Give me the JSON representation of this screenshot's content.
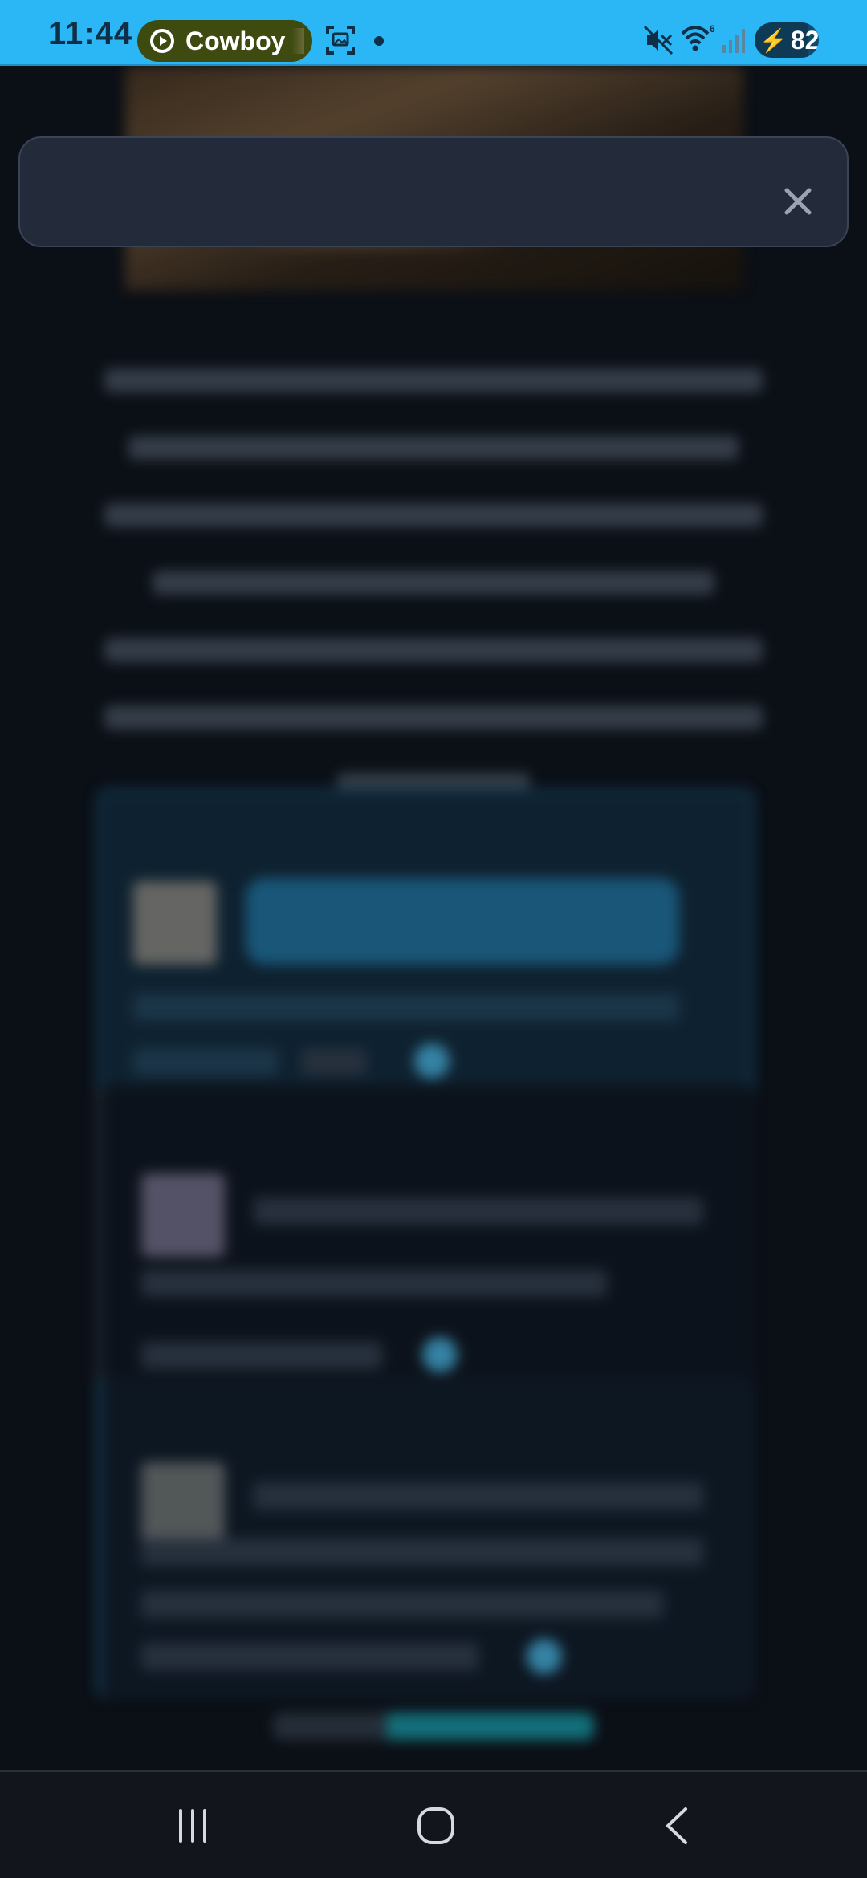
{
  "status_bar": {
    "time": "11:44",
    "media_app": "Cowboy",
    "battery_level": 82,
    "battery_text": "82",
    "colors": {
      "background": "#2bb6f5",
      "pill": "#3d4a10"
    },
    "icons": [
      "play-icon",
      "screenshot-icon",
      "notification-dot-icon",
      "mute-icon",
      "wifi-icon",
      "signal-icon",
      "battery-charging-icon"
    ]
  },
  "toast": {
    "message": "",
    "close_icon": "close-icon"
  },
  "nav_bar": {
    "icons": [
      "recents-icon",
      "home-icon",
      "back-icon"
    ]
  },
  "colors": {
    "page_background": "#0b0f16",
    "toast_background": "#232b3b",
    "accent": "#1b5e83"
  }
}
